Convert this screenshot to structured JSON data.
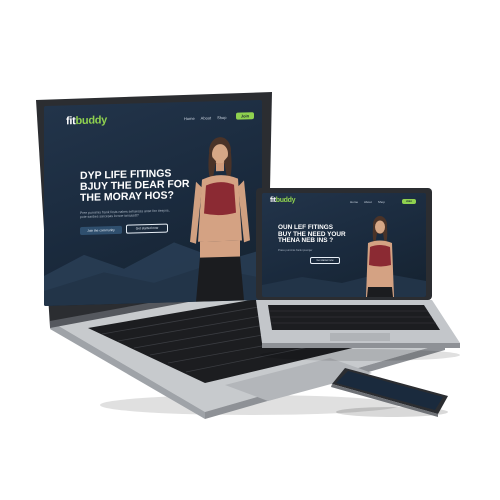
{
  "site": {
    "logo_main": "fit",
    "logo_accent": "buddy",
    "nav": [
      "Home",
      "About",
      "Shop"
    ],
    "cta_label": "Join",
    "headline_large": [
      "DYP LIFE FITINGS",
      "BJUY THE DEAR FOR",
      "THE MORAY HOS?"
    ],
    "headline_small": [
      "OUN LEF FITINGS",
      "BUY THE NEED YOUR",
      "THENA NEB INS ?"
    ],
    "subtext_large": "Pree purnimis frank fosts nahes sehaecas anse fen tiesyns, pote sanbes sarcesas lornoe iancasdt?",
    "subtext_small": "Praxe purnimis frank ipsumjer",
    "btn_primary": "Join the community",
    "btn_secondary": "Get started now"
  },
  "colors": {
    "screen_bg": "#1a2a3d",
    "accent": "#8fd14f",
    "laptop_body": "#b9bcc0",
    "keyboard": "#1c1d20",
    "outfit": "#8b2a33"
  }
}
